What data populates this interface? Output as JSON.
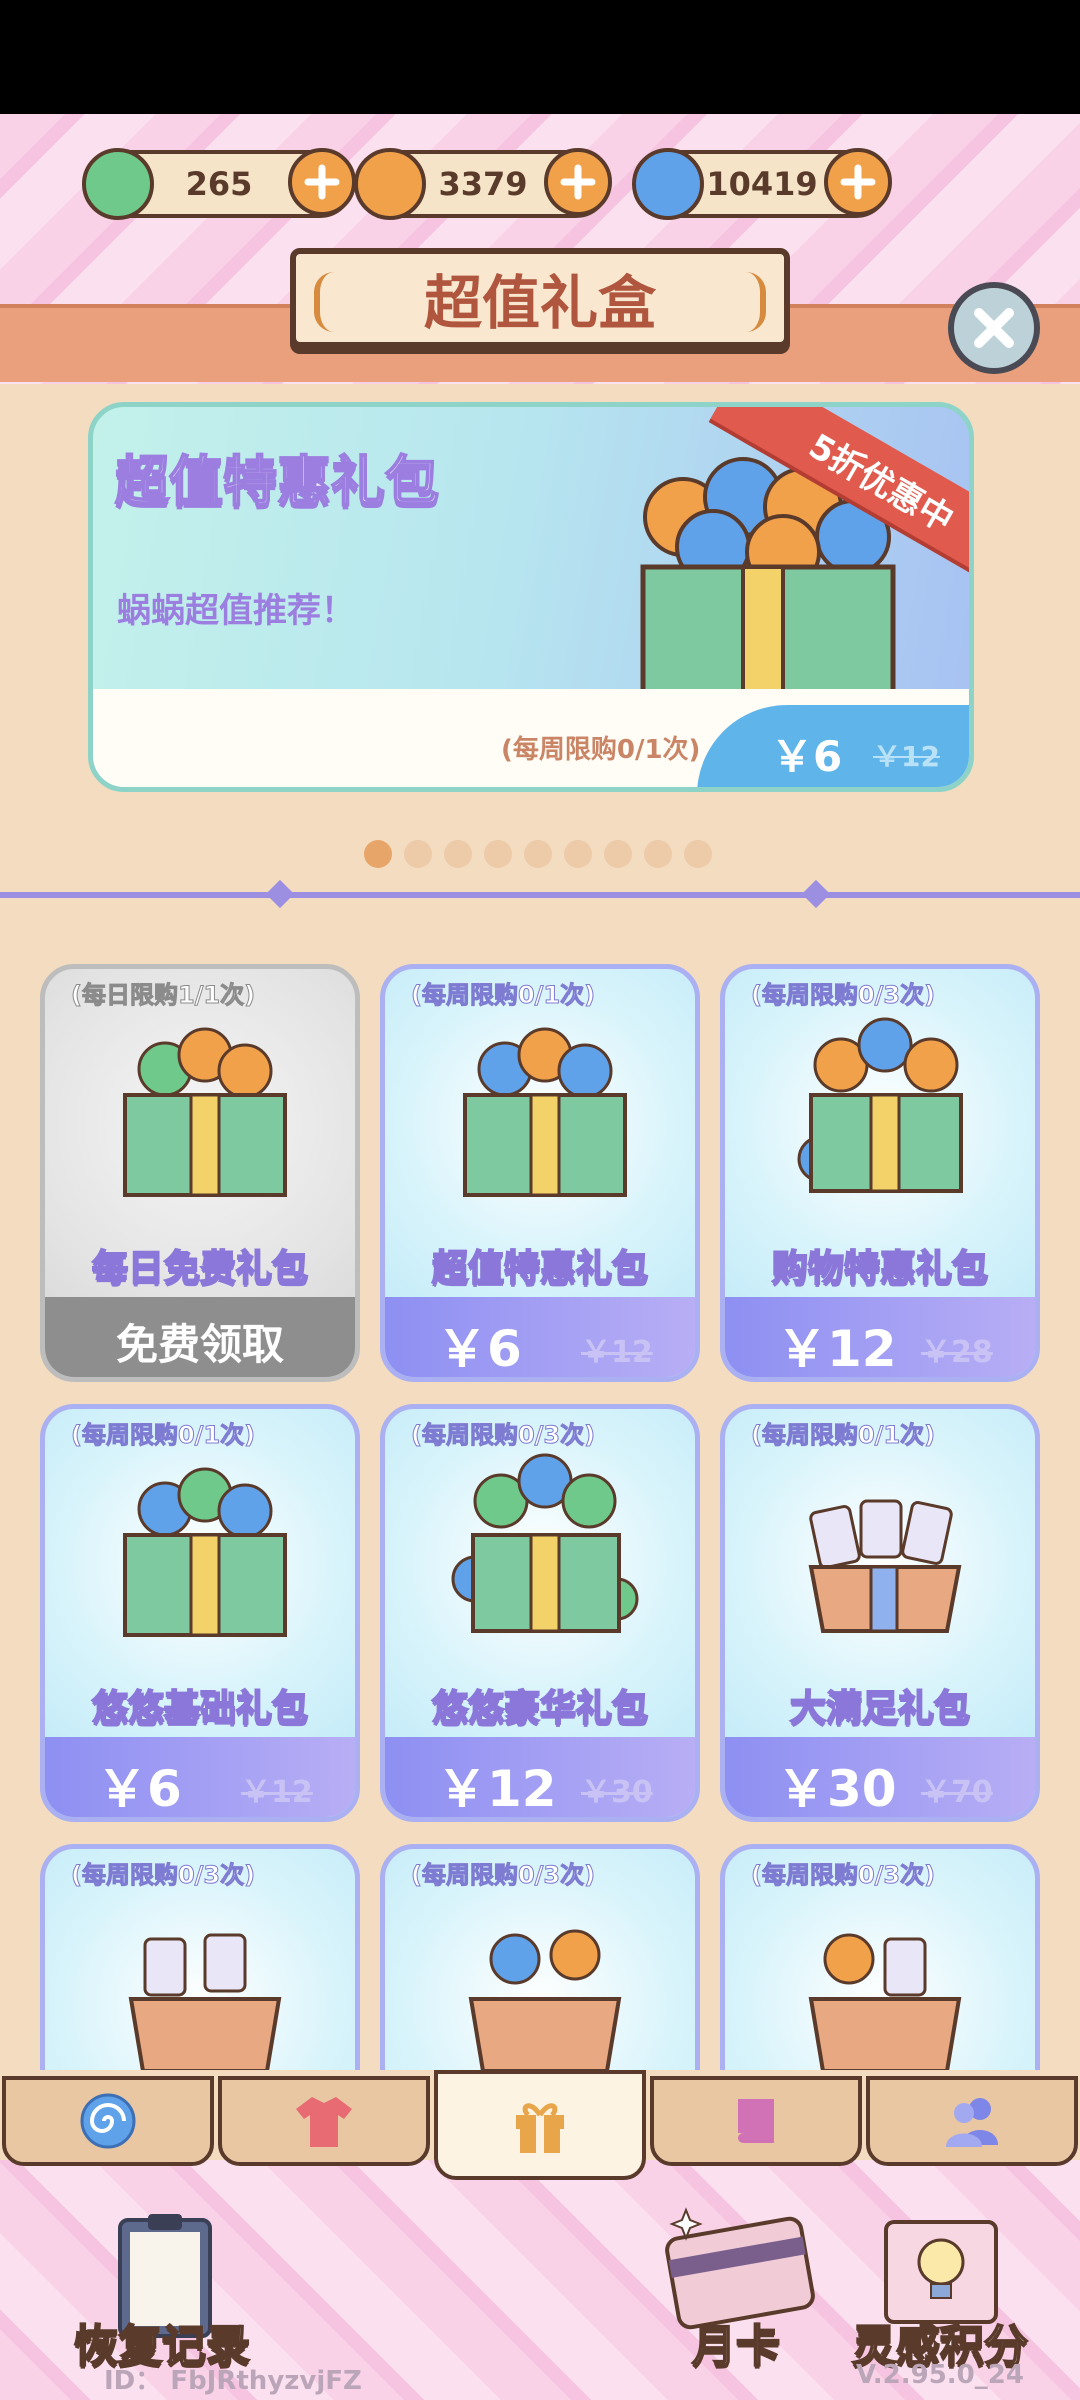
{
  "currencies": [
    {
      "name": "clover",
      "value": "265",
      "color": "#6ec98a"
    },
    {
      "name": "coin",
      "value": "3379",
      "color": "#f2a14b"
    },
    {
      "name": "swirl",
      "value": "10419",
      "color": "#5fa2ea"
    }
  ],
  "header": {
    "title": "超值礼盒"
  },
  "banner": {
    "title": "超值特惠礼包",
    "subtitle": "蜗蜗超值推荐！",
    "ribbon": "5折优惠中",
    "limit": "(每周限购0/1次)",
    "price": "￥6",
    "old_price": "￥12"
  },
  "pager": {
    "count": 9,
    "active": 0
  },
  "cards": [
    {
      "limit": "(每日限购1/1次)",
      "name": "每日免费礼包",
      "free": "免费领取",
      "grey": true
    },
    {
      "limit": "(每周限购0/1次)",
      "name": "超值特惠礼包",
      "price": "￥6",
      "old": "￥12"
    },
    {
      "limit": "(每周限购0/3次)",
      "name": "购物特惠礼包",
      "price": "￥12",
      "old": "￥28"
    },
    {
      "limit": "(每周限购0/1次)",
      "name": "悠悠基础礼包",
      "price": "￥6",
      "old": "￥12"
    },
    {
      "limit": "(每周限购0/3次)",
      "name": "悠悠豪华礼包",
      "price": "￥12",
      "old": "￥30"
    },
    {
      "limit": "(每周限购0/1次)",
      "name": "大满足礼包",
      "price": "￥30",
      "old": "￥70"
    },
    {
      "limit": "(每周限购0/3次)"
    },
    {
      "limit": "(每周限购0/3次)"
    },
    {
      "limit": "(每周限购0/3次)"
    }
  ],
  "tabs": [
    {
      "icon": "swirl-icon",
      "active": false
    },
    {
      "icon": "shirt-icon",
      "active": false
    },
    {
      "icon": "gift-icon",
      "active": true
    },
    {
      "icon": "scroll-icon",
      "active": false
    },
    {
      "icon": "friends-icon",
      "active": false
    }
  ],
  "bottom": {
    "restore_label": "恢复记录",
    "monthly_label": "月卡",
    "inspiration_label": "灵感积分",
    "id_text": "ID： FbJRthyzvjFZ",
    "version": "V.2.95.0_24"
  }
}
